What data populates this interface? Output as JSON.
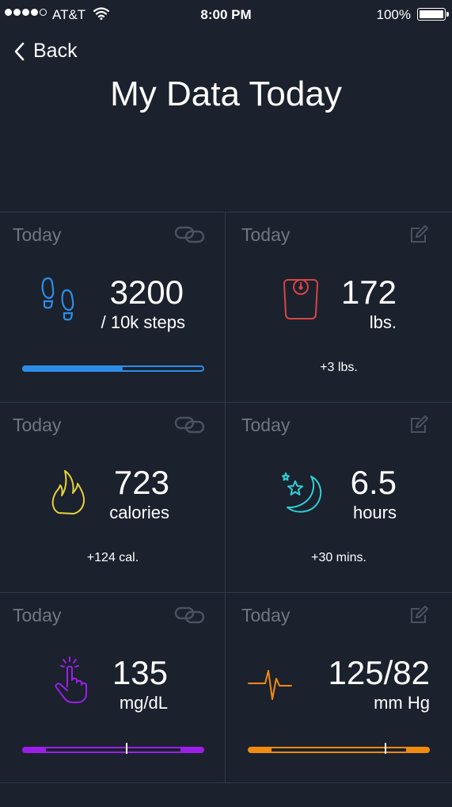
{
  "status_bar": {
    "carrier": "AT&T",
    "time": "8:00 PM",
    "battery": "100%"
  },
  "nav": {
    "back_label": "Back",
    "title": "My Data Today"
  },
  "cards": [
    {
      "header": "Today",
      "value": "3200",
      "unit": "/ 10k steps",
      "progress": 0.55,
      "accent": "#2d8ee8",
      "icon": "footsteps-icon",
      "corner_icon": "link-icon"
    },
    {
      "header": "Today",
      "value": "172",
      "unit": "lbs.",
      "delta": "+3 lbs.",
      "accent": "#d64545",
      "icon": "scale-icon",
      "corner_icon": "edit-icon"
    },
    {
      "header": "Today",
      "value": "723",
      "unit": "calories",
      "delta": "+124 cal.",
      "accent": "#e6d33a",
      "icon": "flame-icon",
      "corner_icon": "link-icon"
    },
    {
      "header": "Today",
      "value": "6.5",
      "unit": "hours",
      "delta": "+30 mins.",
      "accent": "#2ed0d8",
      "icon": "moon-star-icon",
      "corner_icon": "edit-icon"
    },
    {
      "header": "Today",
      "value": "135",
      "unit": "mg/dL",
      "marker": 0.57,
      "accent": "#9b1fe8",
      "icon": "finger-prick-icon",
      "corner_icon": "link-icon"
    },
    {
      "header": "Today",
      "value": "125/82",
      "unit": "mm Hg",
      "marker": 0.75,
      "accent": "#f08a10",
      "icon": "heartbeat-icon",
      "corner_icon": "edit-icon"
    }
  ]
}
